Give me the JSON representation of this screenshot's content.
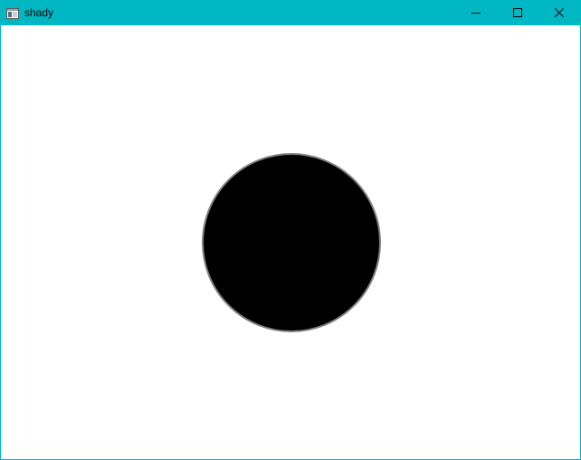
{
  "window": {
    "title": "shady",
    "accent_color": "#00b7c3"
  },
  "titlebar": {
    "app_icon": "window-icon",
    "buttons": [
      {
        "name": "minimize",
        "icon": "minimize-icon"
      },
      {
        "name": "maximize",
        "icon": "maximize-icon"
      },
      {
        "name": "close",
        "icon": "close-icon"
      }
    ]
  },
  "canvas": {
    "background": "#ffffff",
    "shape": "circle",
    "fill_color": "#000000",
    "edge_color": "#808080"
  }
}
